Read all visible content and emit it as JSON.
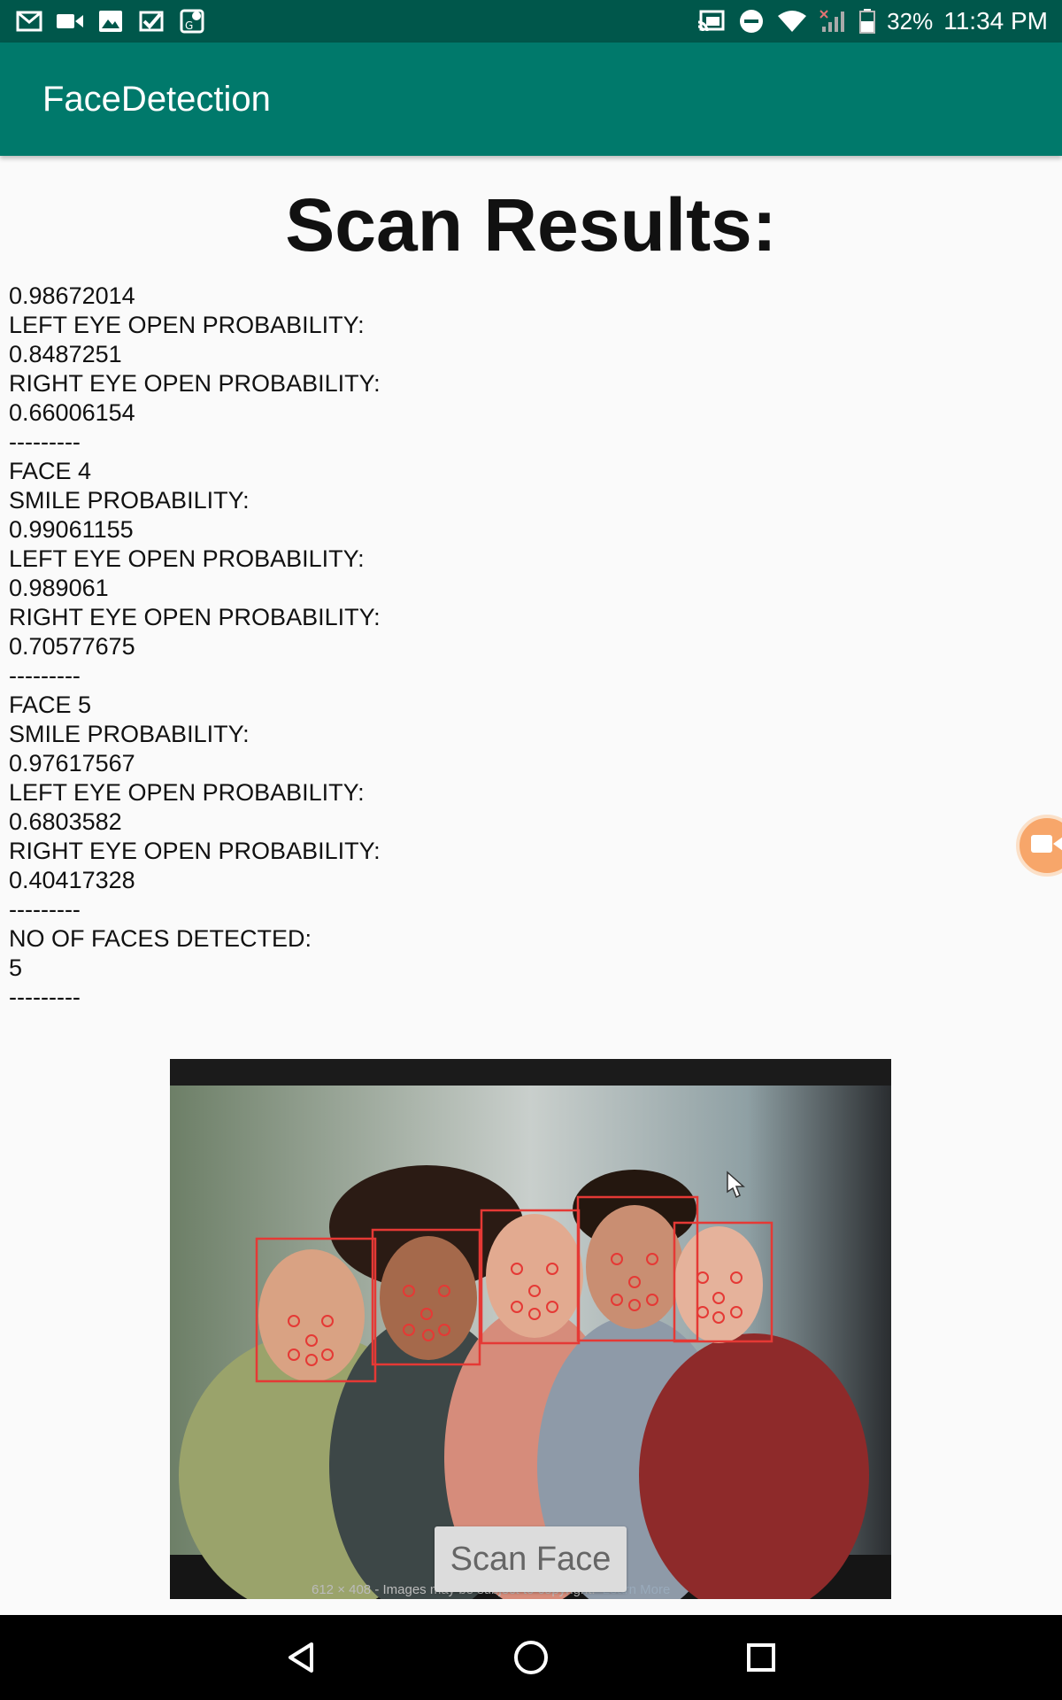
{
  "status_bar": {
    "battery": "32%",
    "time": "11:34 PM",
    "icons_left": [
      "gmail-icon",
      "video-icon",
      "image-icon",
      "check-icon",
      "maps-icon"
    ],
    "icons_right": [
      "cast-icon",
      "dnd-icon",
      "wifi-icon",
      "signal-icon",
      "battery-icon"
    ]
  },
  "app_bar": {
    "title": "FaceDetection"
  },
  "main": {
    "heading": "Scan Results:",
    "lines": [
      "0.98672014",
      "LEFT EYE OPEN PROBABILITY:",
      "0.8487251",
      "RIGHT EYE OPEN PROBABILITY:",
      "0.66006154",
      "---------",
      "FACE 4",
      "SMILE PROBABILITY:",
      "0.99061155",
      "LEFT EYE OPEN PROBABILITY:",
      "0.989061",
      "RIGHT EYE OPEN PROBABILITY:",
      "0.70577675",
      "---------",
      "FACE 5",
      "SMILE PROBABILITY:",
      "0.97617567",
      "LEFT EYE OPEN PROBABILITY:",
      "0.6803582",
      "RIGHT EYE OPEN PROBABILITY:",
      "0.40417328",
      "---------",
      "NO OF FACES DETECTED:",
      "5",
      "---------"
    ],
    "photo_caption": "612 × 408 - Images may be subject to copyright.",
    "photo_caption_link": "Learn More",
    "scan_button": "Scan Face"
  },
  "colors": {
    "status_bar": "#00574B",
    "app_bar": "#00796B",
    "face_box": "#e53935"
  },
  "nav_bar": {
    "icons": [
      "back-icon",
      "home-icon",
      "recents-icon"
    ]
  }
}
